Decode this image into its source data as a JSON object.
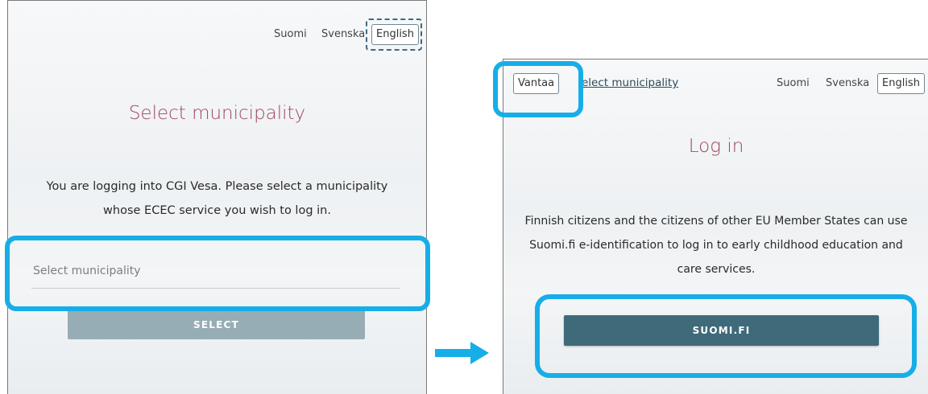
{
  "left_screen": {
    "languages": [
      "Suomi",
      "Svenska",
      "English"
    ],
    "title": "Select municipality",
    "description_line1": "You are logging into CGI Vesa. Please select a municipality",
    "description_line2": "whose ECEC service you wish to log in.",
    "municipality_placeholder": "Select municipality",
    "select_button": "SELECT"
  },
  "right_screen": {
    "municipality_badge": "Vantaa",
    "select_municipality_link": "elect municipality",
    "languages": [
      "Suomi",
      "Svenska",
      "English"
    ],
    "title": "Log in",
    "description_line1": "Finnish citizens and the citizens of other EU Member States can use",
    "description_line2": "Suomi.fi e-identification to log in to early childhood education and",
    "description_line3": "care services.",
    "suomifi_button": "SUOMI.FI"
  },
  "colors": {
    "highlight": "#17aee8",
    "title": "#a0475e",
    "primary_button": "#3f6a7a",
    "disabled_button": "#97adb6"
  }
}
